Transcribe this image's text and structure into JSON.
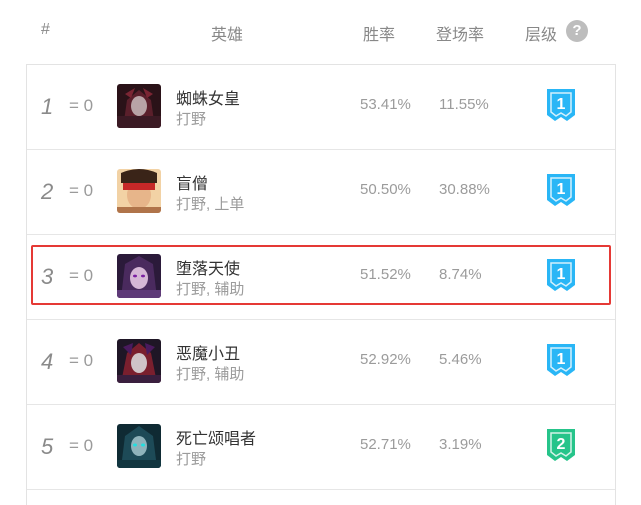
{
  "header": {
    "rank": "#",
    "champion": "英雄",
    "win_rate": "胜率",
    "pick_rate": "登场率",
    "tier": "层级",
    "help": "?"
  },
  "colors": {
    "tier1": "#29b6f6",
    "tier2": "#26c48a",
    "highlight": "#e53935"
  },
  "rows": [
    {
      "rank": "1",
      "trend": "= 0",
      "name": "蜘蛛女皇",
      "roles": "打野",
      "win": "53.41%",
      "pick": "11.55%",
      "tier": "1",
      "icon": "elise-avatar-icon"
    },
    {
      "rank": "2",
      "trend": "= 0",
      "name": "盲僧",
      "roles": "打野, 上单",
      "win": "50.50%",
      "pick": "30.88%",
      "tier": "1",
      "icon": "leesin-avatar-icon"
    },
    {
      "rank": "3",
      "trend": "= 0",
      "name": "堕落天使",
      "roles": "打野, 辅助",
      "win": "51.52%",
      "pick": "8.74%",
      "tier": "1",
      "icon": "morgana-avatar-icon"
    },
    {
      "rank": "4",
      "trend": "= 0",
      "name": "恶魔小丑",
      "roles": "打野, 辅助",
      "win": "52.92%",
      "pick": "5.46%",
      "tier": "1",
      "icon": "shaco-avatar-icon"
    },
    {
      "rank": "5",
      "trend": "= 0",
      "name": "死亡颂唱者",
      "roles": "打野",
      "win": "52.71%",
      "pick": "3.19%",
      "tier": "2",
      "icon": "karthus-avatar-icon"
    }
  ]
}
